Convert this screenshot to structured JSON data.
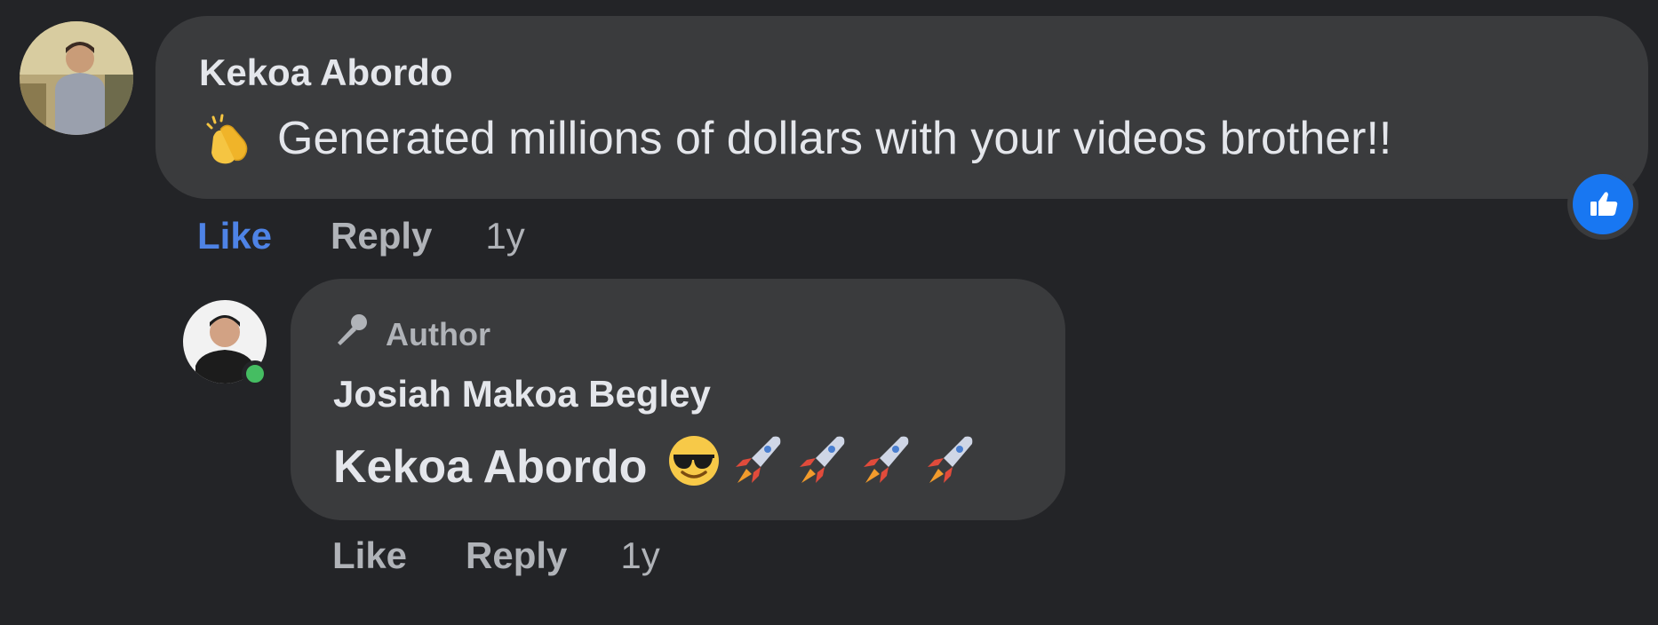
{
  "colors": {
    "background": "#232427",
    "bubble": "#3a3b3d",
    "text": "#e4e6eb",
    "muted": "#b0b3b8",
    "like_active": "#4e83e6",
    "reaction_blue": "#1877f2",
    "online_green": "#45bd62"
  },
  "comment": {
    "author": "Kekoa Abordo",
    "emoji": "clapping-hands",
    "text": "Generated millions of dollars with your videos brother!!",
    "actions": {
      "like": "Like",
      "reply": "Reply",
      "time": "1y"
    },
    "liked": true,
    "reaction": "like-icon"
  },
  "reply": {
    "badge": "Author",
    "badge_icon": "microphone-icon",
    "author": "Josiah Makoa Begley",
    "mention": "Kekoa Abordo",
    "emojis": [
      "smiling-face-with-sunglasses",
      "rocket",
      "rocket",
      "rocket",
      "rocket"
    ],
    "online": true,
    "actions": {
      "like": "Like",
      "reply": "Reply",
      "time": "1y"
    }
  }
}
